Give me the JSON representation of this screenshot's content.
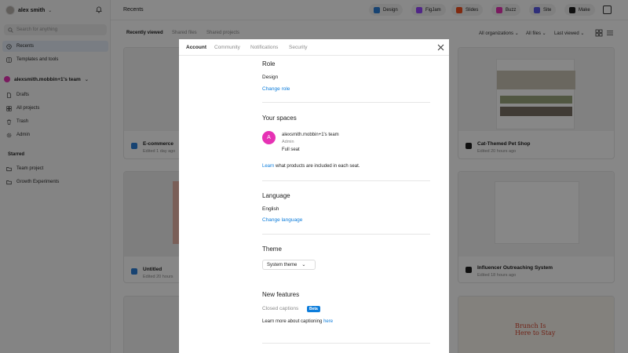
{
  "sidebar": {
    "username": "alex smith",
    "search_placeholder": "Search for anything",
    "nav": [
      {
        "label": "Recents",
        "icon": "clock-icon"
      },
      {
        "label": "Templates and tools",
        "icon": "grid-icon"
      }
    ],
    "team_name": "alexsmith.mobbin+1's team",
    "team_items": [
      {
        "label": "Drafts",
        "icon": "file-icon"
      },
      {
        "label": "All projects",
        "icon": "folders-icon"
      },
      {
        "label": "Trash",
        "icon": "trash-icon"
      },
      {
        "label": "Admin",
        "icon": "gear-icon"
      }
    ],
    "starred_heading": "Starred",
    "starred_items": [
      {
        "label": "Team project",
        "icon": "folder-icon"
      },
      {
        "label": "Growth Experiments",
        "icon": "folder-icon"
      }
    ]
  },
  "topbar": {
    "title": "Recents",
    "products": [
      {
        "label": "Design",
        "color": "#2d7fd8"
      },
      {
        "label": "FigJam",
        "color": "#9747ff"
      },
      {
        "label": "Slides",
        "color": "#f24e1e"
      },
      {
        "label": "Buzz",
        "color": "#e632b4"
      },
      {
        "label": "Site",
        "color": "#5a5ae6"
      },
      {
        "label": "Make",
        "color": "#1e1e1e"
      }
    ]
  },
  "filterbar": {
    "tabs": [
      "Recently viewed",
      "Shared files",
      "Shared projects"
    ],
    "filters": [
      "All organizations",
      "All files",
      "Last viewed"
    ]
  },
  "cards": [
    {
      "title": "E-commerce",
      "sub": "Edited 1 day ago"
    },
    {
      "title": "Cat-Themed Pet Shop",
      "sub": "Edited 20 hours ago"
    },
    {
      "title": "Untitled",
      "sub": "Edited 20 hours"
    },
    {
      "title": "Influencer Outreaching System",
      "sub": "Edited 18 hours ago"
    },
    {
      "title": "Brunch Is Here to Stay",
      "sub": ""
    }
  ],
  "modal": {
    "tabs": [
      "Account",
      "Community",
      "Notifications",
      "Security"
    ],
    "role": {
      "heading": "Role",
      "value": "Design",
      "link": "Change role"
    },
    "spaces": {
      "heading": "Your spaces",
      "avatar_letter": "A",
      "team": "alexsmith.mobbin+1's team",
      "role": "Admin",
      "seat": "Full seat",
      "learn_link": "Learn",
      "learn_text": "what products are included in each seat."
    },
    "language": {
      "heading": "Language",
      "value": "English",
      "link": "Change language"
    },
    "theme": {
      "heading": "Theme",
      "value": "System theme"
    },
    "new_features": {
      "heading": "New features",
      "item": "Closed captions",
      "badge": "Beta",
      "learn_text": "Learn more about captioning",
      "learn_link": "here"
    }
  }
}
